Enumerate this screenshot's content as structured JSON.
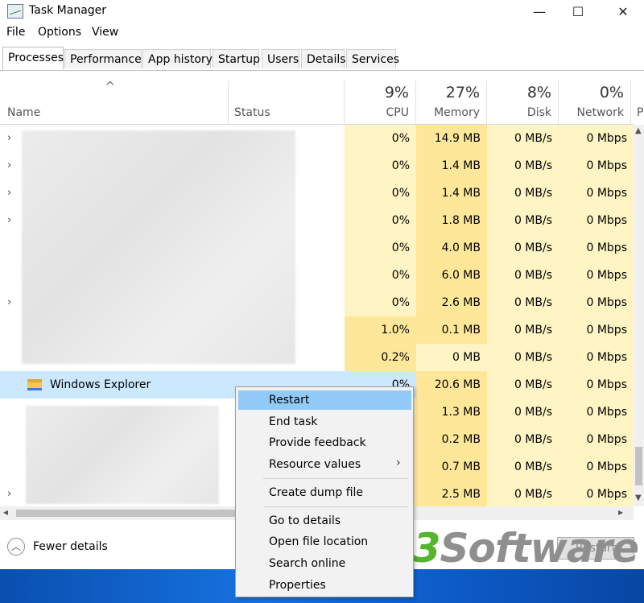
{
  "window": {
    "title": "Task Manager",
    "minimize": "—",
    "maximize": "☐",
    "close": "✕"
  },
  "menu": [
    "File",
    "Options",
    "View"
  ],
  "tabs": [
    "Processes",
    "Performance",
    "App history",
    "Startup",
    "Users",
    "Details",
    "Services"
  ],
  "columns": {
    "sort_arrow": "^",
    "name": "Name",
    "status": "Status",
    "cpu": {
      "pct": "9%",
      "label": "CPU"
    },
    "memory": {
      "pct": "27%",
      "label": "Memory"
    },
    "disk": {
      "pct": "8%",
      "label": "Disk"
    },
    "network": {
      "pct": "0%",
      "label": "Network"
    },
    "extra": "P"
  },
  "rows": [
    {
      "name": "",
      "cpu": "0%",
      "memory": "14.9 MB",
      "disk": "0 MB/s",
      "network": "0 Mbps",
      "chevron": "›"
    },
    {
      "name": "",
      "cpu": "0%",
      "memory": "1.4 MB",
      "disk": "0 MB/s",
      "network": "0 Mbps",
      "chevron": "›"
    },
    {
      "name": "",
      "cpu": "0%",
      "memory": "1.4 MB",
      "disk": "0 MB/s",
      "network": "0 Mbps",
      "chevron": "›"
    },
    {
      "name": "",
      "cpu": "0%",
      "memory": "1.8 MB",
      "disk": "0 MB/s",
      "network": "0 Mbps",
      "chevron": "›"
    },
    {
      "name": "",
      "cpu": "0%",
      "memory": "4.0 MB",
      "disk": "0 MB/s",
      "network": "0 Mbps",
      "chevron": ""
    },
    {
      "name": "",
      "cpu": "0%",
      "memory": "6.0 MB",
      "disk": "0 MB/s",
      "network": "0 Mbps",
      "chevron": ""
    },
    {
      "name": "",
      "cpu": "0%",
      "memory": "2.6 MB",
      "disk": "0 MB/s",
      "network": "0 Mbps",
      "chevron": "›"
    },
    {
      "name": "",
      "cpu": "1.0%",
      "memory": "0.1 MB",
      "disk": "0 MB/s",
      "network": "0 Mbps",
      "chevron": ""
    },
    {
      "name": "",
      "cpu": "0.2%",
      "memory": "0 MB",
      "disk": "0 MB/s",
      "network": "0 Mbps",
      "chevron": ""
    },
    {
      "name": "Windows Explorer",
      "cpu": "0%",
      "memory": "20.6 MB",
      "disk": "0 MB/s",
      "network": "0 Mbps",
      "chevron": ""
    },
    {
      "name": "",
      "cpu": "",
      "memory": "1.3 MB",
      "disk": "0 MB/s",
      "network": "0 Mbps",
      "chevron": ""
    },
    {
      "name": "",
      "cpu": "",
      "memory": "0.2 MB",
      "disk": "0 MB/s",
      "network": "0 Mbps",
      "chevron": ""
    },
    {
      "name": "",
      "cpu": "",
      "memory": "0.7 MB",
      "disk": "0 MB/s",
      "network": "0 Mbps",
      "chevron": ""
    },
    {
      "name": "",
      "cpu": "",
      "memory": "2.5 MB",
      "disk": "0 MB/s",
      "network": "0 Mbps",
      "chevron": "›"
    }
  ],
  "context_menu": [
    "Restart",
    "End task",
    "Provide feedback",
    "Resource values",
    "Create dump file",
    "Go to details",
    "Open file location",
    "Search online",
    "Properties"
  ],
  "footer": {
    "fewer_details": "Fewer details",
    "restart_button": "Restart"
  },
  "watermark": {
    "m3": "M3",
    "software": "Software"
  },
  "colors": {
    "heat_light": "#fff4c4",
    "heat_mid": "#ffe79a",
    "selected_row": "#cce8ff",
    "menu_highlight": "#91c9f7",
    "wm_green": "#55b52c",
    "wm_gray": "#8f8f8f"
  }
}
